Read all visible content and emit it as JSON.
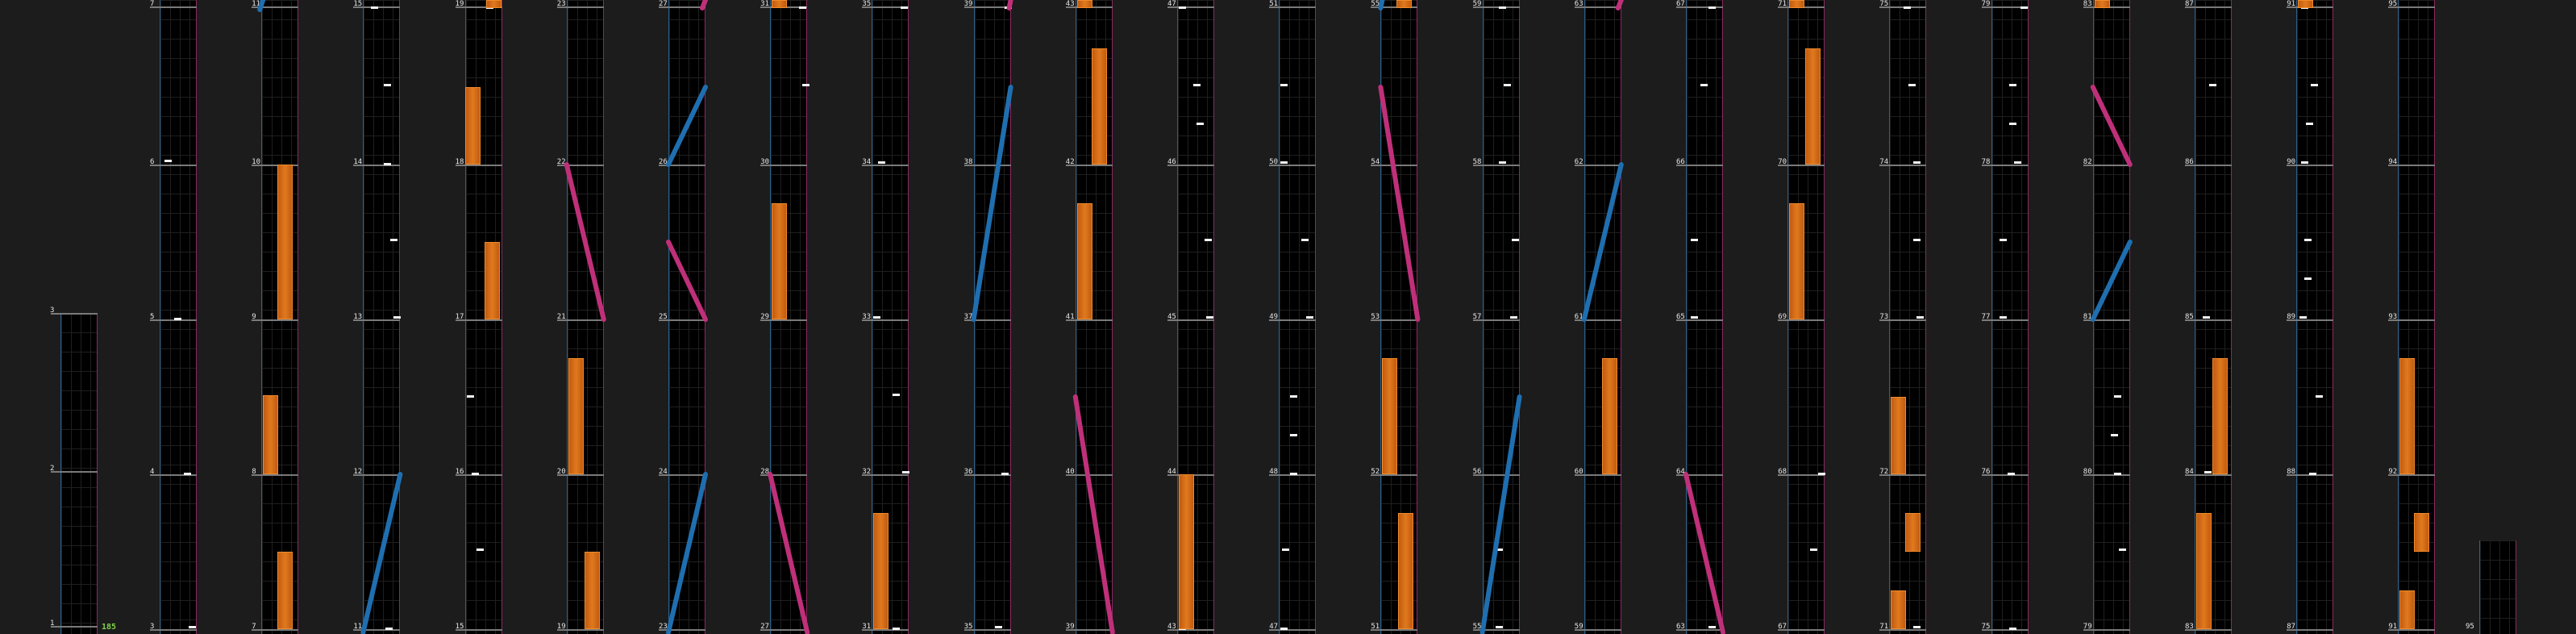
{
  "columns": [
    {
      "measures": [
        3
      ]
    },
    {
      "measures": [
        7,
        6,
        5,
        4,
        3
      ]
    },
    {
      "measures": [
        11,
        10,
        9,
        8,
        7
      ]
    },
    {
      "measures": [
        15,
        14,
        13,
        12,
        11
      ]
    },
    {
      "measures": [
        19,
        18,
        17,
        16,
        15
      ]
    },
    {
      "measures": [
        23,
        22,
        21,
        20,
        19
      ]
    },
    {
      "measures": [
        27,
        26,
        25,
        24,
        23
      ]
    },
    {
      "measures": [
        31,
        30,
        29,
        28,
        27
      ]
    },
    {
      "measures": [
        35,
        34,
        33,
        32,
        31
      ]
    },
    {
      "measures": [
        39,
        38,
        37,
        36,
        35
      ]
    },
    {
      "measures": [
        43,
        42,
        41,
        40,
        39
      ]
    },
    {
      "measures": [
        47,
        46,
        45,
        44,
        43
      ]
    },
    {
      "measures": [
        51,
        50,
        49,
        48,
        47
      ]
    },
    {
      "measures": [
        55,
        54,
        53,
        52,
        51
      ]
    },
    {
      "measures": [
        59,
        58,
        57,
        56,
        55
      ]
    },
    {
      "measures": [
        63,
        62,
        61,
        60,
        59
      ]
    },
    {
      "measures": [
        67,
        66,
        65,
        64,
        63
      ]
    },
    {
      "measures": [
        71,
        70,
        69,
        68,
        67
      ]
    },
    {
      "measures": [
        75,
        74,
        73,
        72,
        71
      ]
    },
    {
      "measures": [
        79,
        78,
        77,
        76,
        75
      ]
    },
    {
      "measures": [
        83,
        82,
        81,
        80,
        79
      ]
    },
    {
      "measures": [
        87,
        86,
        85,
        84,
        83
      ]
    },
    {
      "measures": [
        91,
        90,
        89,
        88,
        87
      ]
    },
    {
      "measures": [
        95,
        94,
        93,
        92,
        91
      ]
    },
    {
      "measures": [
        95
      ]
    }
  ],
  "first_column_measures": [
    3,
    2,
    1
  ],
  "combo": "185",
  "colors": {
    "background": "#1c1c1c",
    "lane": "#000000",
    "lane_left_border": "#2a5f8a",
    "lane_right_border": "#8a2a60",
    "hold": "#e07a1e",
    "note": "#f4f4f4",
    "slide_blue": "#1f6fb0",
    "slide_pink": "#c0307a",
    "combo_text": "#7fd24a"
  }
}
